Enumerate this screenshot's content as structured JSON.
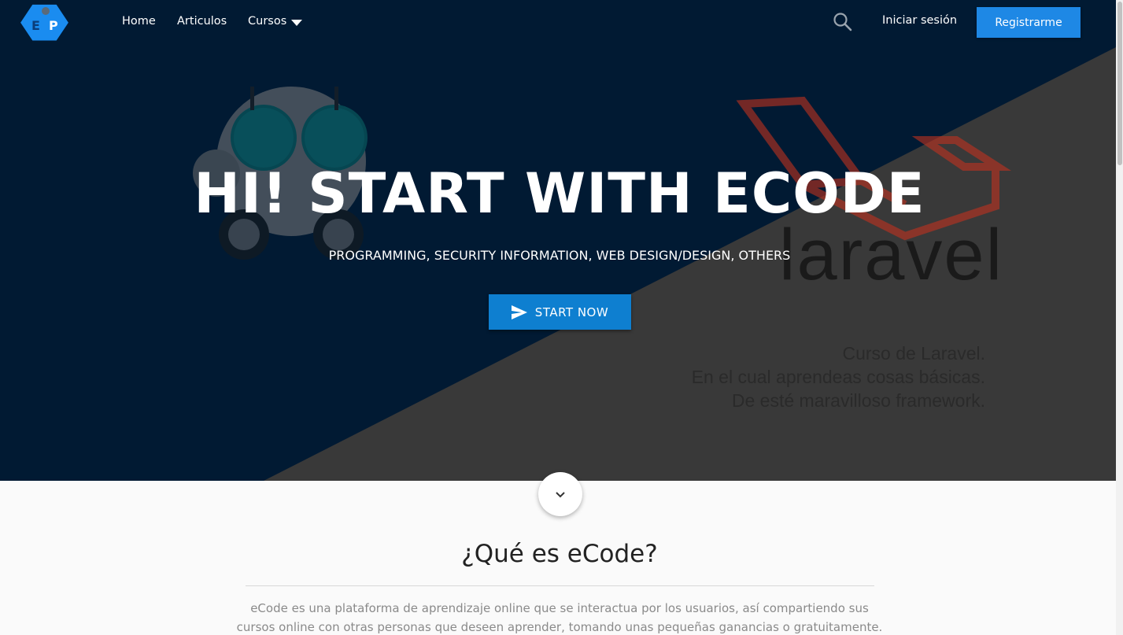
{
  "nav": {
    "logo_letters": [
      "E",
      "P"
    ],
    "links": [
      {
        "label": "Home"
      },
      {
        "label": "Articulos"
      },
      {
        "label": "Cursos"
      }
    ],
    "login_label": "Iniciar sesión",
    "register_label": "Registrarme"
  },
  "hero": {
    "title": "HI! START WITH ECODE",
    "subtitle": "PROGRAMMING, SECURITY INFORMATION, WEB DESIGN/DESIGN, OTHERS",
    "cta_label": "START NOW",
    "laravel_word": "laravel",
    "laravel_caption": [
      "Curso de Laravel.",
      "En el cual aprendeas cosas básicas.",
      "De esté maravilloso framework."
    ]
  },
  "about": {
    "title": "¿Qué es eCode?",
    "text": "eCode es una plataforma de aprendizaje online que se interactua por los usuarios, así compartiendo sus cursos online con otras personas que deseen aprender, tomando unas pequeñas ganancias o gratuitamente."
  },
  "colors": {
    "hero_dark": "#011a33",
    "hero_gray": "#3a3a3a",
    "accent": "#1e88e5",
    "cta": "#0e7fd0",
    "laravel_red": "#c0321f"
  },
  "icons": [
    "logo-icon",
    "chevron-down-icon",
    "search-icon",
    "send-icon",
    "expand-more-icon"
  ]
}
